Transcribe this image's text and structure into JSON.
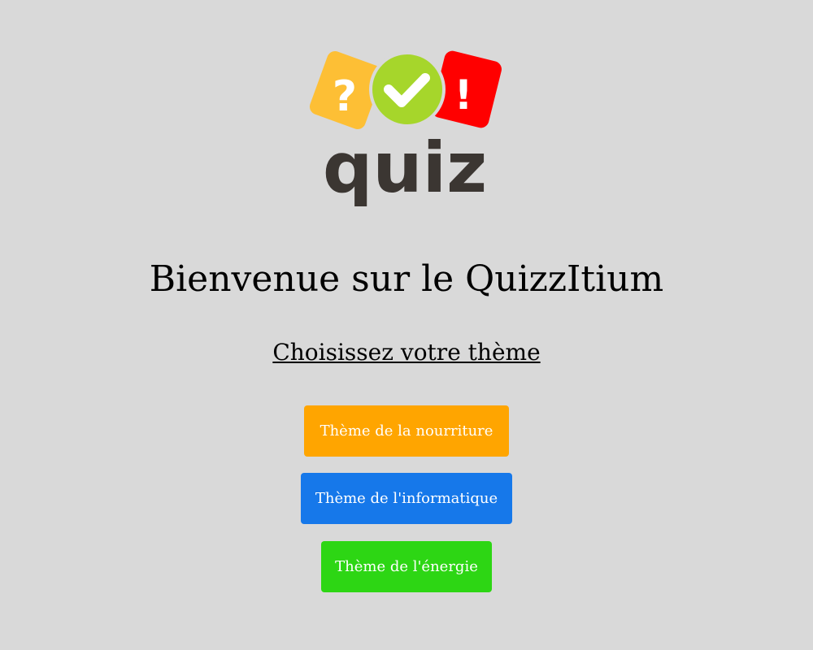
{
  "logo": {
    "text": "quiz",
    "icons": [
      "question-mark-icon",
      "checkmark-icon",
      "exclamation-mark-icon"
    ],
    "colors": {
      "question_tile": "#fdbf35",
      "check_circle": "#a6d62b",
      "exclamation_tile": "#ff0000",
      "wordmark": "#3b3632"
    }
  },
  "header": {
    "title": "Bienvenue sur le QuizzItium",
    "subtitle": "Choisissez votre thème"
  },
  "themes": [
    {
      "label": "Thème de la nourriture",
      "color": "#ffa500"
    },
    {
      "label": "Thème de l'informatique",
      "color": "#1678ea"
    },
    {
      "label": "Thème de l'énergie",
      "color": "#2dd614"
    }
  ],
  "page": {
    "background": "#d9d9d9"
  }
}
